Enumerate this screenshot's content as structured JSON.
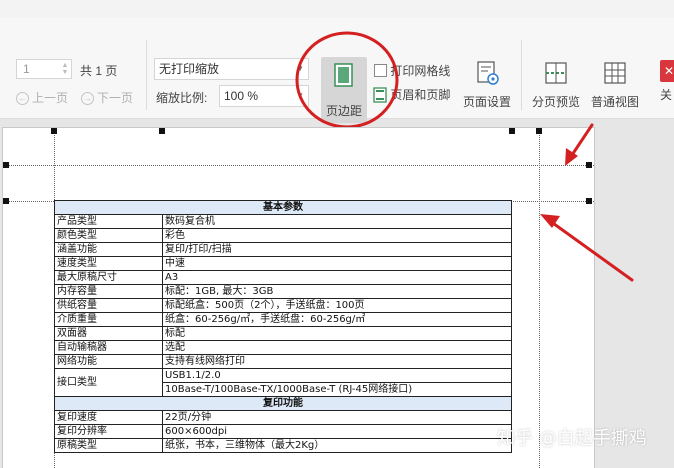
{
  "toolbar": {
    "page_input_value": "1",
    "total_pages": "共 1 页",
    "prev_page": "上一页",
    "next_page": "下一页",
    "scale_mode": "无打印缩放",
    "zoom_label": "缩放比例:",
    "zoom_value": "100 %",
    "margins_button": "页边距",
    "print_gridlines": "打印网格线",
    "header_footer": "页眉和页脚",
    "page_setup": "页面设置",
    "page_break_preview": "分页预览",
    "normal_view": "普通视图",
    "close_partial": "关"
  },
  "table": {
    "section1_title": "基本参数",
    "rows1": [
      {
        "key": "产品类型",
        "value": "数码复合机"
      },
      {
        "key": "颜色类型",
        "value": "彩色"
      },
      {
        "key": "涵盖功能",
        "value": "复印/打印/扫描"
      },
      {
        "key": "速度类型",
        "value": "中速"
      },
      {
        "key": "最大原稿尺寸",
        "value": "A3"
      },
      {
        "key": "内存容量",
        "value": "标配：1GB, 最大：3GB"
      },
      {
        "key": "供纸容量",
        "value": "标配纸盒：500页（2个），手送纸盘：100页"
      },
      {
        "key": "介质重量",
        "value": "纸盒：60-256g/㎡，手送纸盘：60-256g/㎡"
      },
      {
        "key": "双面器",
        "value": "标配"
      },
      {
        "key": "自动输稿器",
        "value": "选配"
      },
      {
        "key": "网络功能",
        "value": "支持有线网络打印"
      }
    ],
    "interface_key": "接口类型",
    "interface_values": [
      "USB1.1/2.0",
      "10Base-T/100Base-TX/1000Base-T (RJ-45网络接口)"
    ],
    "section2_title": "复印功能",
    "rows2": [
      {
        "key": "复印速度",
        "value": "22页/分钟"
      },
      {
        "key": "复印分辨率",
        "value": "600×600dpi"
      },
      {
        "key": "原稿类型",
        "value": "纸张，书本，三维物体（最大2Kg）"
      }
    ]
  },
  "watermark": "知乎 @白起手撕鸡",
  "colors": {
    "annotation_red": "#d42020",
    "table_header_bg": "#dde9f6",
    "margins_button_bg": "#d6d6d6"
  }
}
